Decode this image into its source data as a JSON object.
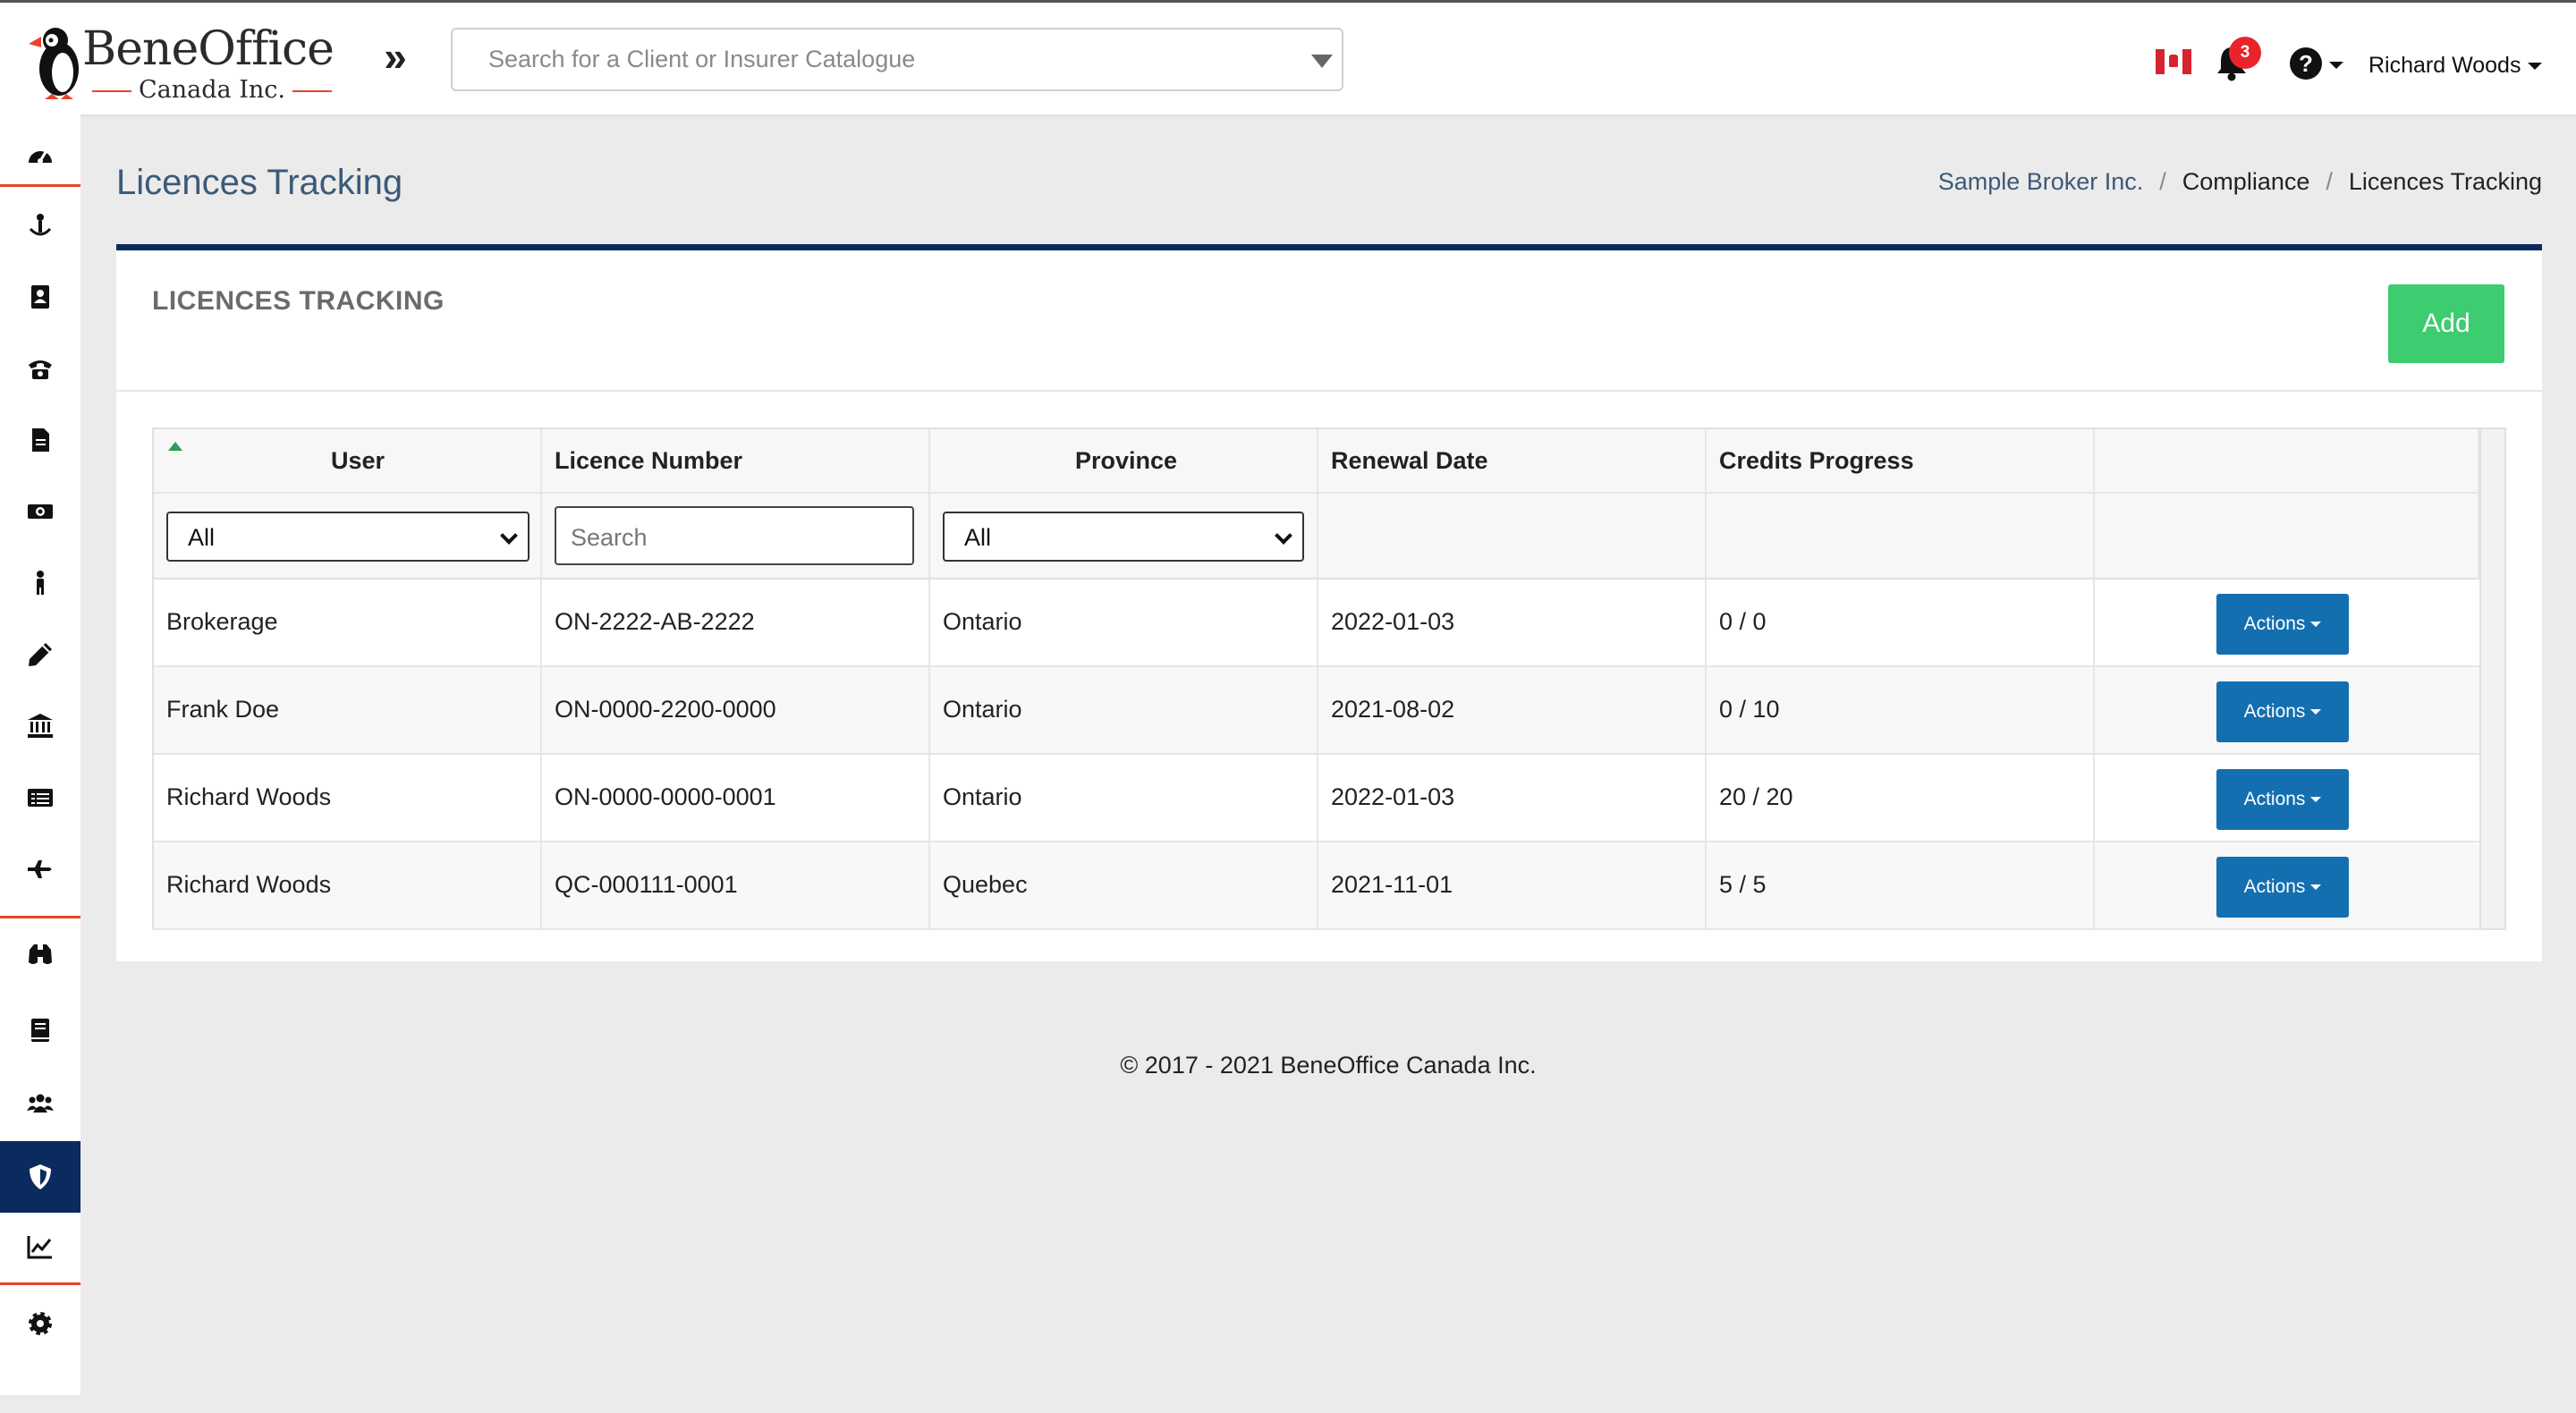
{
  "app": {
    "logo_title": "BeneOffice",
    "logo_subtitle": "Canada Inc."
  },
  "header": {
    "search_placeholder": "Search for a Client or Insurer Catalogue",
    "notification_count": "3",
    "help_icon": "?",
    "user_name": "Richard Woods",
    "icons": [
      "puffin-logo-icon",
      "double-chevron-right-icon",
      "canada-flag-icon",
      "bell-icon",
      "question-circle-icon"
    ]
  },
  "sidebar": {
    "icons": [
      "tachometer-icon",
      "anchor-user-icon",
      "address-book-icon",
      "phone-icon",
      "file-icon",
      "money-icon",
      "person-icon",
      "pencil-icon",
      "bank-icon",
      "list-alt-icon",
      "plane-icon",
      "binoculars-icon",
      "book-icon",
      "users-icon",
      "shield-icon",
      "chart-line-icon",
      "cog-icon"
    ],
    "active": "shield-icon"
  },
  "page": {
    "title": "Licences Tracking",
    "breadcrumb": [
      "Sample Broker Inc.",
      "Compliance",
      "Licences Tracking"
    ],
    "separator": "/"
  },
  "card": {
    "title": "LICENCES TRACKING",
    "add_label": "Add"
  },
  "table": {
    "columns": [
      "User",
      "Licence Number",
      "Province",
      "Renewal Date",
      "Credits Progress",
      ""
    ],
    "filters": {
      "user": "All",
      "licence_placeholder": "Search",
      "province": "All"
    },
    "rows": [
      {
        "user": "Brokerage",
        "licence": "ON-2222-AB-2222",
        "province": "Ontario",
        "renewal": "2022-01-03",
        "credits": "0 / 0",
        "action": "Actions"
      },
      {
        "user": "Frank Doe",
        "licence": "ON-0000-2200-0000",
        "province": "Ontario",
        "renewal": "2021-08-02",
        "credits": "0 / 10",
        "action": "Actions"
      },
      {
        "user": "Richard Woods",
        "licence": "ON-0000-0000-0001",
        "province": "Ontario",
        "renewal": "2022-01-03",
        "credits": "20 / 20",
        "action": "Actions"
      },
      {
        "user": "Richard Woods",
        "licence": "QC-000111-0001",
        "province": "Quebec",
        "renewal": "2021-11-01",
        "credits": "5 / 5",
        "action": "Actions"
      }
    ]
  },
  "footer": {
    "text": "© 2017 - 2021 BeneOffice Canada Inc."
  },
  "colors": {
    "navy": "#0b2a5e",
    "accent_red": "#e8442c",
    "add_green": "#3dcc6f",
    "actions_blue": "#136fb0",
    "badge_red": "#e8242a"
  }
}
